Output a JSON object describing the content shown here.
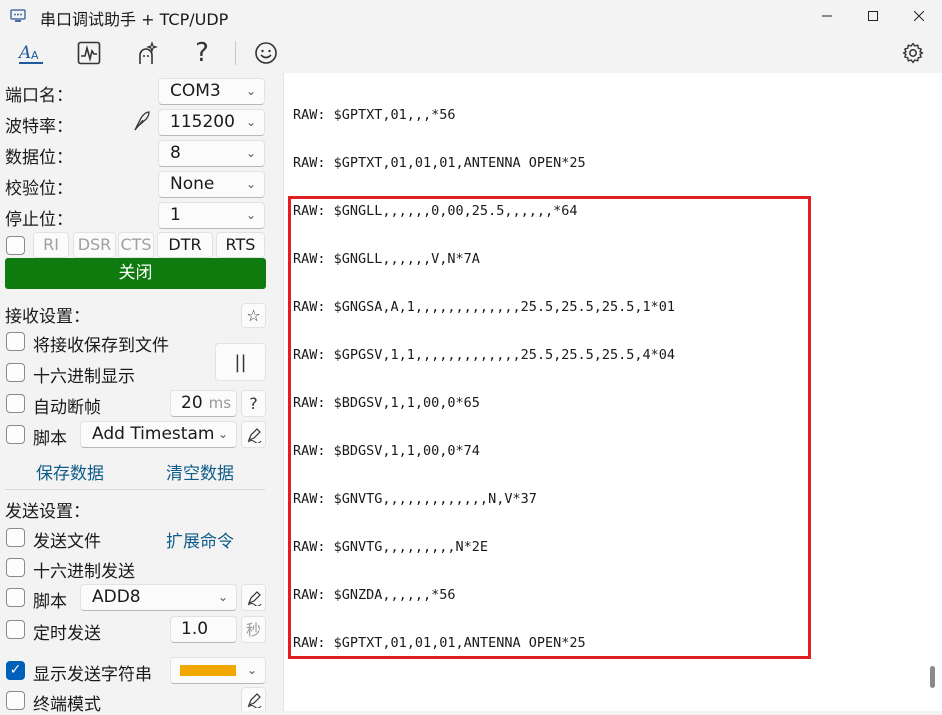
{
  "window": {
    "title": "串口调试助手 + TCP/UDP"
  },
  "serial": {
    "port_label": "端口名：",
    "port_value": "COM3",
    "baud_label": "波特率：",
    "baud_value": "115200",
    "databits_label": "数据位：",
    "databits_value": "8",
    "parity_label": "校验位：",
    "parity_value": "None",
    "stopbits_label": "停止位：",
    "stopbits_value": "1",
    "flags": [
      "RI",
      "DSR",
      "CTS",
      "DTR",
      "RTS"
    ],
    "close_button": "关闭"
  },
  "receive": {
    "section_label": "接收设置：",
    "save_to_file": "将接收保存到文件",
    "hex_display": "十六进制显示",
    "pause_label": "||",
    "auto_frame": "自动断帧",
    "frame_value": "20",
    "frame_unit": "ms",
    "help_label": "?",
    "script_label": "脚本",
    "script_value": "Add Timestam",
    "save_data": "保存数据",
    "clear_data": "清空数据"
  },
  "send": {
    "section_label": "发送设置：",
    "send_file": "发送文件",
    "ext_cmd": "扩展命令",
    "hex_send": "十六进制发送",
    "script_label": "脚本",
    "script_value": "ADD8",
    "timed_send": "定时发送",
    "timed_value": "1.0",
    "timed_unit": "秒",
    "show_send_str": "显示发送字符串",
    "show_send_str_checked": true,
    "terminal_mode": "终端模式",
    "color_swatch": "#f0a800"
  },
  "console": {
    "lines": [
      "RAW: $GPTXT,01,,,*56",
      "RAW: $GPTXT,01,01,01,ANTENNA OPEN*25",
      "RAW: $GNGLL,,,,,,0,00,25.5,,,,,,*64",
      "RAW: $GNGLL,,,,,,V,N*7A",
      "RAW: $GNGSA,A,1,,,,,,,,,,,,,25.5,25.5,25.5,1*01",
      "RAW: $GPGSV,1,1,,,,,,,,,,,,,25.5,25.5,25.5,4*04",
      "RAW: $BDGSV,1,1,00,0*65",
      "RAW: $BDGSV,1,1,00,0*74",
      "RAW: $GNVTG,,,,,,,,,,,,,N,V*37",
      "RAW: $GNVTG,,,,,,,,,N*2E",
      "RAW: $GNZDA,,,,,,*56",
      "RAW: $GPTXT,01,01,01,ANTENNA OPEN*25"
    ]
  },
  "colors": {
    "accent": "#005fb8",
    "close_button": "#0f7b0f",
    "highlight_box": "#e02020"
  }
}
